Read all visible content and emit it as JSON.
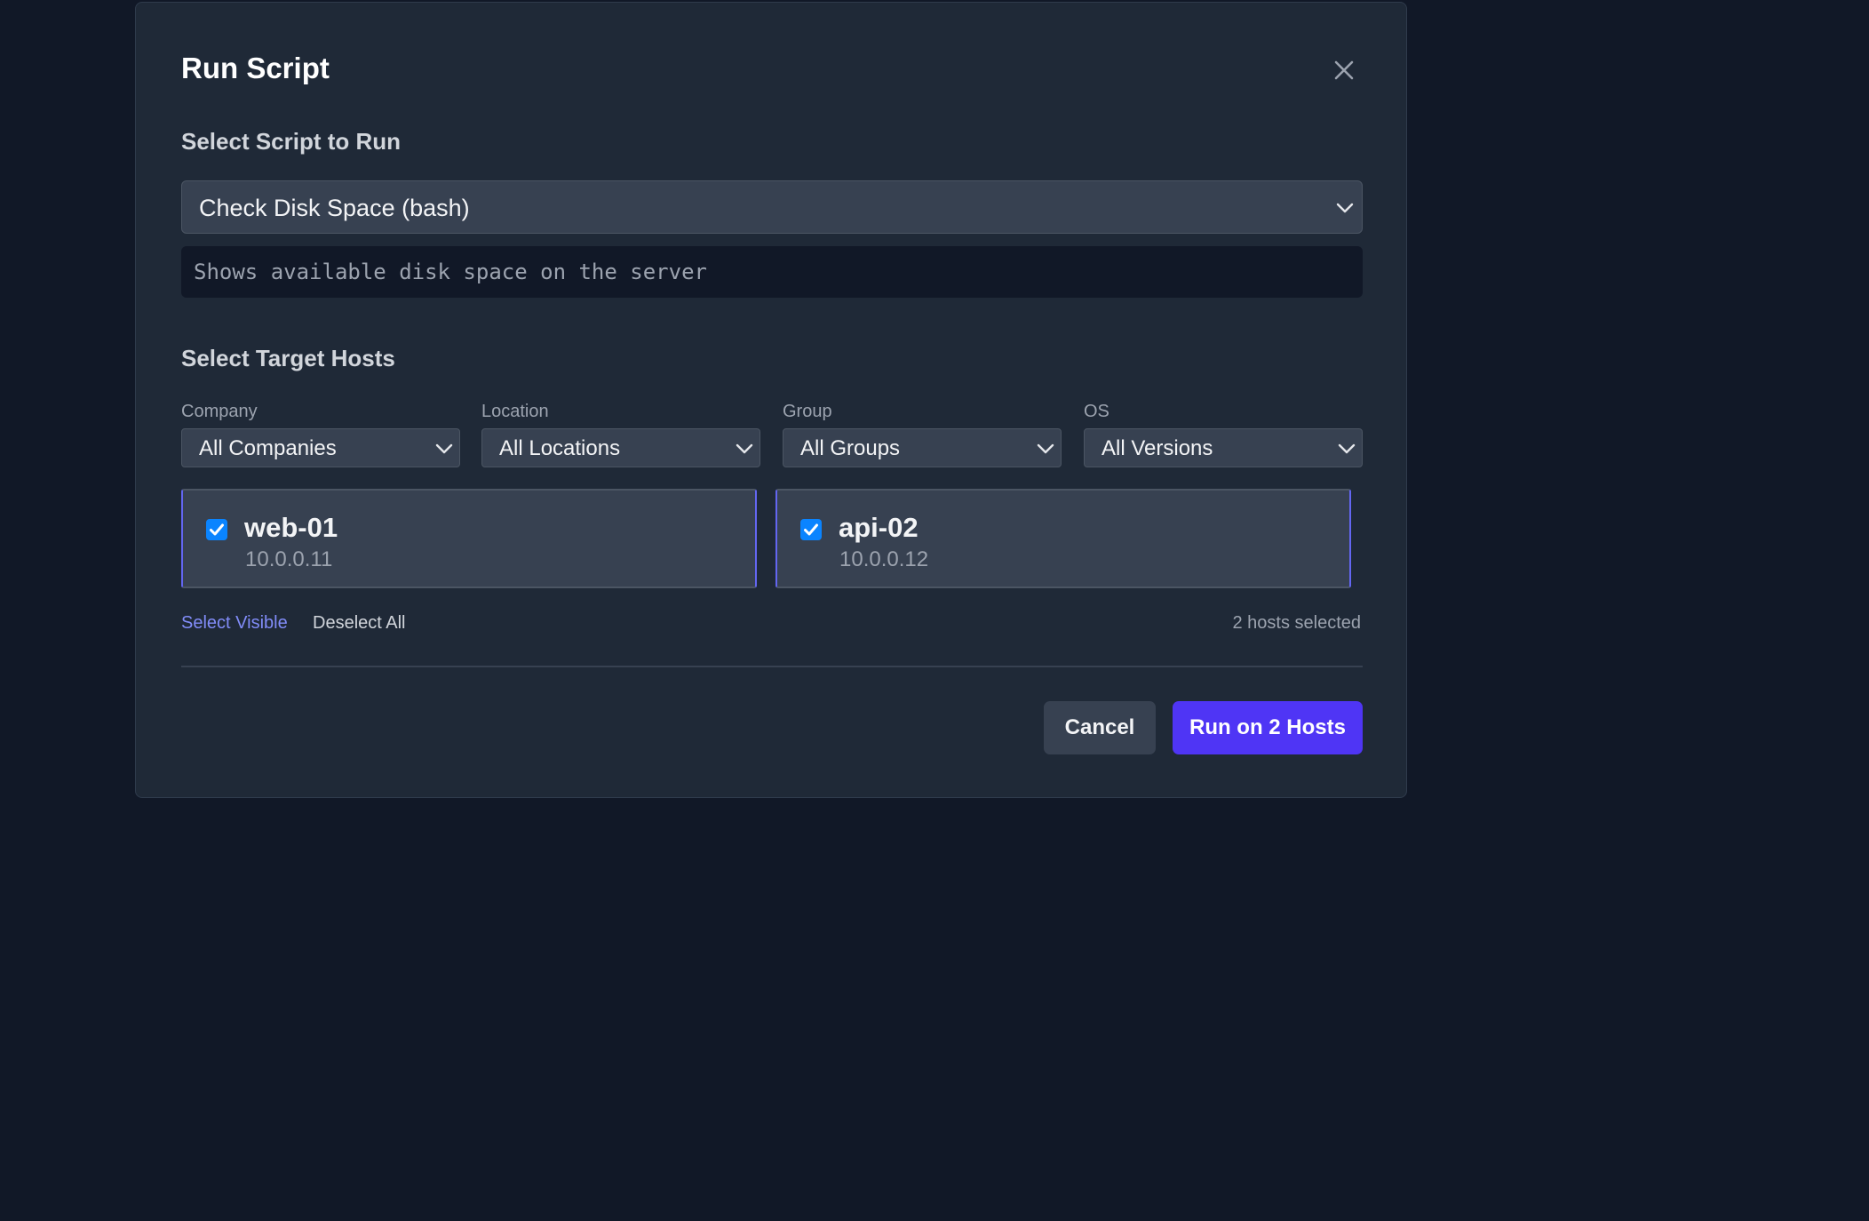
{
  "modal": {
    "title": "Run Script",
    "close_icon": "close-icon"
  },
  "script_section": {
    "label": "Select Script to Run",
    "selected_script": "Check Disk Space (bash)",
    "description": "Shows available disk space on the server"
  },
  "hosts_section": {
    "label": "Select Target Hosts",
    "filters": [
      {
        "label": "Company",
        "value": "All Companies"
      },
      {
        "label": "Location",
        "value": "All Locations"
      },
      {
        "label": "Group",
        "value": "All Groups"
      },
      {
        "label": "OS",
        "value": "All Versions"
      }
    ],
    "hosts": [
      {
        "name": "web-01",
        "ip": "10.0.0.11",
        "checked": true
      },
      {
        "name": "api-02",
        "ip": "10.0.0.12",
        "checked": true
      }
    ],
    "select_visible_label": "Select Visible",
    "deselect_all_label": "Deselect All",
    "selected_count_text": "2 hosts selected"
  },
  "footer": {
    "cancel_label": "Cancel",
    "run_label": "Run on 2 Hosts"
  },
  "colors": {
    "background": "#111827",
    "modal": "#1f2937",
    "accent": "#4f35f5",
    "link_accent": "#818cf8",
    "checkbox": "#0a84ff"
  }
}
